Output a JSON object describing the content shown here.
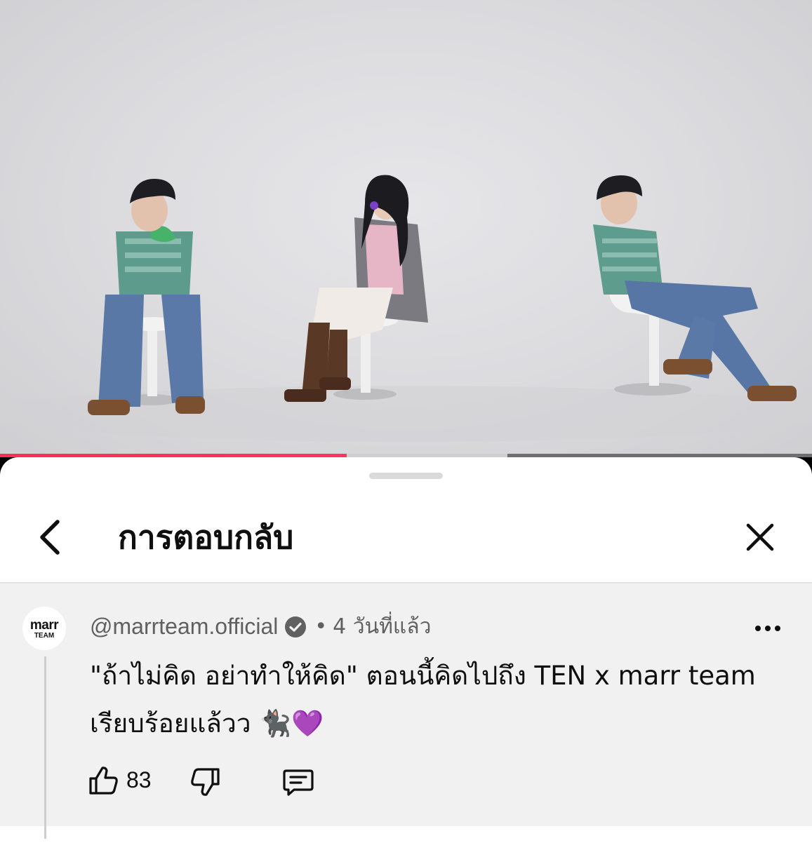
{
  "video": {
    "progress": 0.427,
    "buffered": 0.625,
    "colors": {
      "progress": "#ff2c55",
      "buffered": "#cfcfcf",
      "track": "#6f6f6f"
    }
  },
  "sheet": {
    "title": "การตอบกลับ",
    "back_icon": "chevron-left-icon",
    "close_icon": "close-icon"
  },
  "comment": {
    "avatar_line1": "marr",
    "avatar_line2": "TEAM",
    "username": "@marrteam.official",
    "verified_icon": "verified-badge-icon",
    "separator": "•",
    "time": "4 วันที่แล้ว",
    "text": "\"ถ้าไม่คิด อย่าทำให้คิด\" ตอนนี้คิดไปถึง TEN x marr team เรียบร้อยแล้วว 🐈‍⬛💜",
    "likes": "83",
    "more_icon": "more-options-icon",
    "like_icon": "thumbs-up-icon",
    "dislike_icon": "thumbs-down-icon",
    "reply_icon": "reply-comment-icon"
  }
}
